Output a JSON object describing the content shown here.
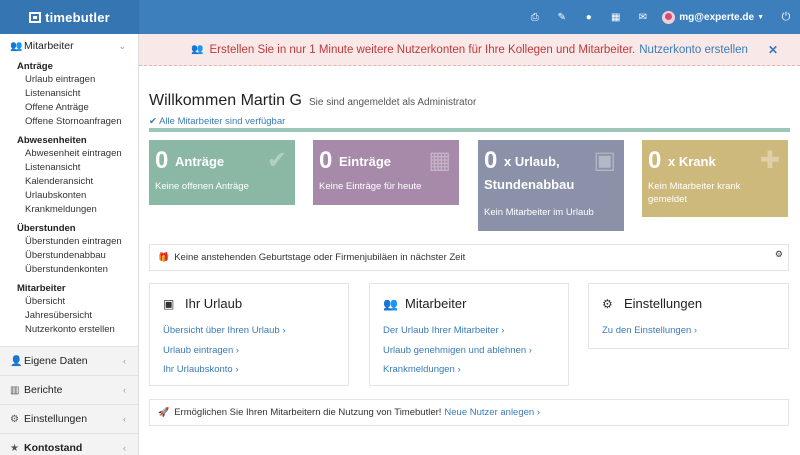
{
  "app": {
    "logo_text": "timebutler"
  },
  "topbar": {
    "icons": [
      "print-icon",
      "brush-icon",
      "globe-icon",
      "calendar-icon",
      "mail-icon"
    ],
    "user_email": "mg@experte.de",
    "power_icon": "power-icon"
  },
  "sidebar": {
    "mitarbeiter": {
      "label": "Mitarbeiter",
      "groups": [
        {
          "title": "Anträge",
          "links": [
            "Urlaub eintragen",
            "Listenansicht",
            "Offene Anträge",
            "Offene Stornoanfragen"
          ]
        },
        {
          "title": "Abwesenheiten",
          "links": [
            "Abwesenheit eintragen",
            "Listenansicht",
            "Kalenderansicht",
            "Urlaubskonten",
            "Krankmeldungen"
          ]
        },
        {
          "title": "Überstunden",
          "links": [
            "Überstunden eintragen",
            "Überstundenabbau",
            "Überstundenkonten"
          ]
        },
        {
          "title": "Mitarbeiter",
          "links": [
            "Übersicht",
            "Jahresübersicht",
            "Nutzerkonto erstellen"
          ]
        }
      ]
    },
    "collapsed": [
      {
        "label": "Eigene Daten",
        "icon": "user-icon"
      },
      {
        "label": "Berichte",
        "icon": "bar-chart-icon"
      },
      {
        "label": "Einstellungen",
        "icon": "gear-icon"
      },
      {
        "label": "Kontostand",
        "icon": "star-icon"
      }
    ]
  },
  "alert": {
    "text": "Erstellen Sie in nur 1 Minute weitere Nutzerkonten für Ihre Kollegen und Mitarbeiter.",
    "link": "Nutzerkonto erstellen",
    "close": "✕"
  },
  "welcome": {
    "title": "Willkommen Martin G",
    "subtitle": "Sie sind angemeldet als Administrator",
    "availability": "Alle Mitarbeiter sind verfügbar"
  },
  "tiles": [
    {
      "num": "0",
      "title": "Anträge",
      "desc": "Keine offenen Anträge",
      "color": "#8ab8a4",
      "icon": "check-icon"
    },
    {
      "num": "0",
      "title": "Einträge",
      "desc": "Keine Einträge für heute",
      "color": "#a78aaa",
      "icon": "calendar-icon"
    },
    {
      "num": "0",
      "title_line1": "x Urlaub,",
      "title_line2": "Stundenabbau",
      "desc": "Kein Mitarbeiter im Urlaub",
      "color": "#8a91a8",
      "icon": "suitcase-icon"
    },
    {
      "num": "0",
      "title": "x Krank",
      "desc_line1": "Kein Mitarbeiter krank",
      "desc_line2": "gemeldet",
      "color": "#cdb97c",
      "icon": "plus-icon"
    }
  ],
  "birthday": {
    "text": "Keine anstehenden Geburtstage oder Firmenjubiläen in nächster Zeit"
  },
  "cards": [
    {
      "title": "Ihr Urlaub",
      "icon": "suitcase-icon",
      "links": [
        "Übersicht über Ihren Urlaub ›",
        "Urlaub eintragen ›",
        "Ihr Urlaubskonto ›"
      ]
    },
    {
      "title": "Mitarbeiter",
      "icon": "users-icon",
      "links": [
        "Der Urlaub Ihrer Mitarbeiter ›",
        "Urlaub genehmigen und ablehnen ›",
        "Krankmeldungen ›"
      ]
    },
    {
      "title": "Einstellungen",
      "icon": "gear-icon",
      "links": [
        "Zu den Einstellungen ›"
      ]
    }
  ],
  "promo": {
    "text": "Ermöglichen Sie Ihren Mitarbeitern die Nutzung von Timebutler!",
    "link": "Neue Nutzer anlegen ›"
  }
}
